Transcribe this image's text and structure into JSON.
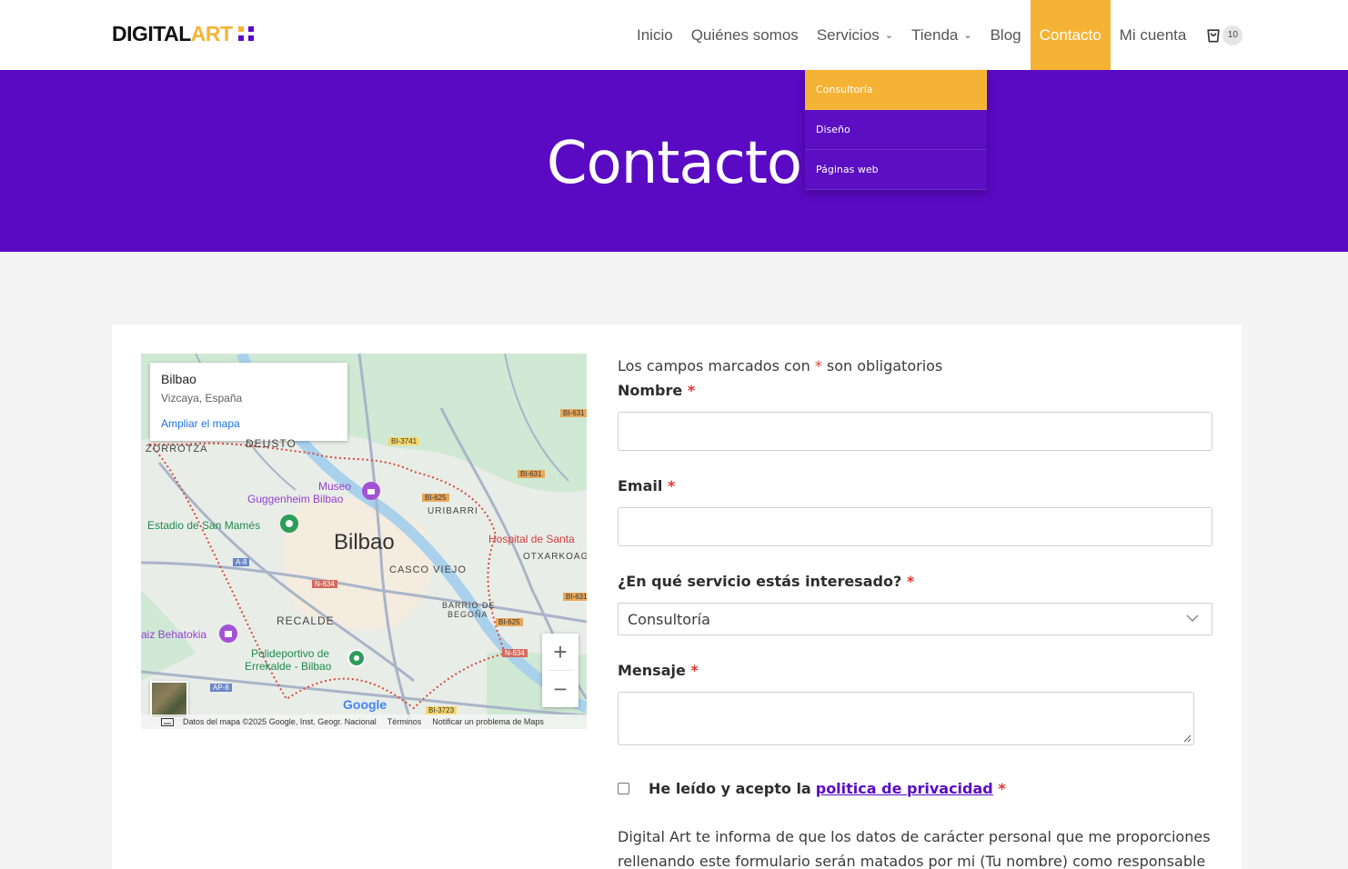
{
  "brand": {
    "logo_part1": "DIGITAL",
    "logo_part2": "ART",
    "accent": "#f5b335",
    "primary": "#5a0ac3"
  },
  "nav": {
    "items": [
      {
        "label": "Inicio"
      },
      {
        "label": "Quiénes somos"
      },
      {
        "label": "Servicios"
      },
      {
        "label": "Tienda"
      },
      {
        "label": "Blog"
      },
      {
        "label": "Contacto"
      },
      {
        "label": "Mi cuenta"
      }
    ],
    "cart_count": "10"
  },
  "dropdown": {
    "items": [
      {
        "label": "Consultoría"
      },
      {
        "label": "Diseño"
      },
      {
        "label": "Páginas web"
      }
    ]
  },
  "hero": {
    "title": "Contacto"
  },
  "map": {
    "info_title": "Bilbao",
    "info_subtitle": "Vizcaya, España",
    "info_link": "Ampliar el mapa",
    "labels": {
      "bilbao": "Bilbao",
      "deusto": "DEUSTO",
      "zorrotza": "ZORROTZA",
      "museo1": "Museo",
      "museo2": "Guggenheim Bilbao",
      "estadio": "Estadio de San Mamés",
      "uribarri": "URIBARRI",
      "hospital": "Hospital de Santa",
      "otxarkoaga": "OTXARKOAG",
      "casco": "CASCO VIEJO",
      "barrio1": "BARRIO DE",
      "barrio2": "BEGOÑA",
      "recalde": "RECALDE",
      "polid1": "Polideportivo de",
      "polid2": "Errekalde - Bilbao",
      "behatokia": "aiz Behatokia",
      "a8": "A-8",
      "n634a": "N-634",
      "n634b": "N-634",
      "ap8": "AP-8",
      "bi631a": "BI-631",
      "bi631b": "BI-631",
      "bi631c": "BI-631",
      "bi3741": "BI-3741",
      "bi625a": "BI-625",
      "bi625b": "BI-625",
      "bi3723": "BI-3723",
      "google": "Google"
    },
    "footer_data": "Datos del mapa ©2025 Google, Inst. Geogr. Nacional",
    "footer_terms": "Términos",
    "footer_report": "Notificar un problema de Maps"
  },
  "form": {
    "required_note_pre": "Los campos marcados con",
    "required_note_star": "*",
    "required_note_post": "son obligatorios",
    "name_label": "Nombre",
    "email_label": "Email",
    "service_label": "¿En qué servicio estás interesado?",
    "service_value": "Consultoría",
    "message_label": "Mensaje",
    "required_star": "*",
    "privacy_pre": "He leído y acepto la",
    "privacy_link": "politica de privacidad",
    "legal_text": "Digital Art te informa de que los datos de carácter personal que me proporciones rellenando este formulario serán matados por mi (Tu nombre) como responsable de"
  }
}
